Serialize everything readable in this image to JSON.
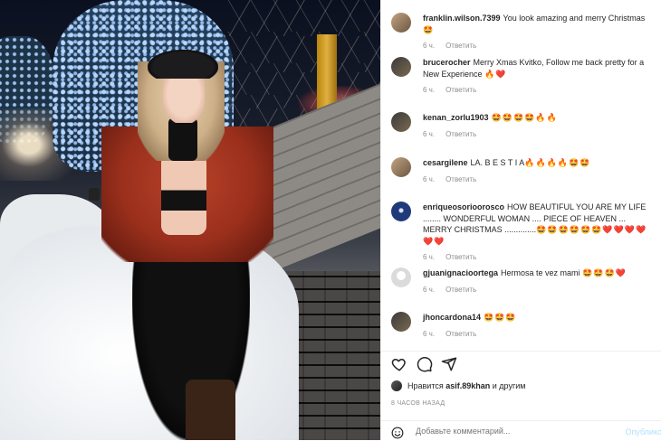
{
  "post": {
    "image_alt": "Photo post"
  },
  "comments": [
    {
      "user": "franklin.wilson.7399",
      "text": "You look amazing and merry Christmas",
      "emoji": "🤩",
      "time": "6 ч.",
      "reply": "Ответить",
      "avatar": "tan"
    },
    {
      "user": "brucerocher",
      "text": "Merry Xmas Kvitko, Follow me back pretty for a New Experience",
      "emoji": "🔥❤️",
      "time": "6 ч.",
      "reply": "Ответить",
      "avatar": "dark"
    },
    {
      "user": "kenan_zorlu1903",
      "text": "",
      "emoji": "🤩🤩🤩🤩🔥🔥",
      "time": "6 ч.",
      "reply": "Ответить",
      "avatar": "dark"
    },
    {
      "user": "cesargilene",
      "text": "LA. B E S T I A",
      "emoji": "🔥🔥🔥🔥🤩🤩",
      "time": "6 ч.",
      "reply": "Ответить",
      "avatar": "tan"
    },
    {
      "user": "enriqueosorioorosco",
      "text": "HOW BEAUTIFUL YOU ARE MY LIFE ........ WONDERFUL WOMAN .... PIECE OF HEAVEN ... MERRY CHRISTMAS ..............",
      "emoji": "🤩🤩🤩🤩🤩🤩❤️❤️❤️❤️❤️❤️",
      "time": "6 ч.",
      "reply": "Ответить",
      "avatar": "blue"
    },
    {
      "user": "gjuanignacioortega",
      "text": "Hermosa te vez mami",
      "emoji": "🤩🤩🤩❤️",
      "time": "6 ч.",
      "reply": "Ответить",
      "avatar": "grey"
    },
    {
      "user": "jhoncardona14",
      "text": "",
      "emoji": "🤩🤩🤩",
      "time": "6 ч.",
      "reply": "Ответить",
      "avatar": "dark"
    }
  ],
  "likes": {
    "prefix": "Нравится",
    "user": "asif.89khan",
    "suffix": "и другим"
  },
  "timestamp": "8 ЧАСОВ НАЗАД",
  "add_comment": {
    "placeholder": "Добавьте комментарий...",
    "publish": "Опублико"
  },
  "colors": {
    "link_blue": "#b2dffc",
    "muted": "#8e8e8e",
    "text": "#262626"
  }
}
